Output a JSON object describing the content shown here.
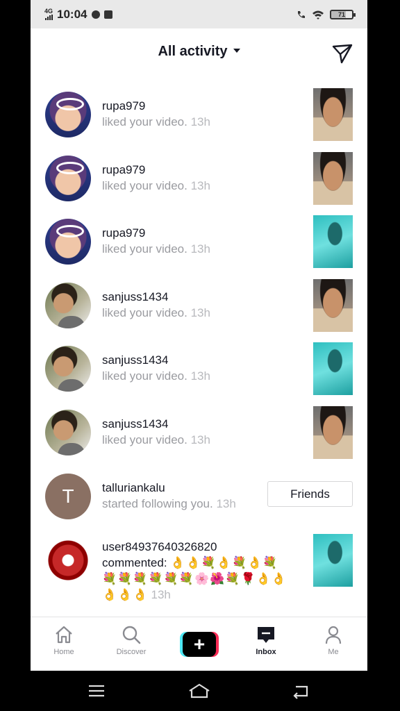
{
  "status_bar": {
    "network": "4G",
    "time": "10:04",
    "battery": "71"
  },
  "header": {
    "title": "All activity",
    "send_icon": "paper-plane-icon"
  },
  "notifications": [
    {
      "username": "rupa979",
      "action": "liked your video.",
      "time": "13h",
      "avatar": "girl",
      "thumb": "face"
    },
    {
      "username": "rupa979",
      "action": "liked your video.",
      "time": "13h",
      "avatar": "girl",
      "thumb": "face"
    },
    {
      "username": "rupa979",
      "action": "liked your video.",
      "time": "13h",
      "avatar": "girl",
      "thumb": "teal"
    },
    {
      "username": "sanjuss1434",
      "action": "liked your video.",
      "time": "13h",
      "avatar": "man",
      "thumb": "face"
    },
    {
      "username": "sanjuss1434",
      "action": "liked your video.",
      "time": "13h",
      "avatar": "man",
      "thumb": "teal"
    },
    {
      "username": "sanjuss1434",
      "action": "liked your video.",
      "time": "13h",
      "avatar": "man",
      "thumb": "face"
    }
  ],
  "follow": {
    "username": "talluriankalu",
    "avatar_letter": "T",
    "action": "started following you.",
    "time": "13h",
    "button_label": "Friends"
  },
  "comment": {
    "username": "user84937640326820",
    "action": "commented:",
    "emojis_line1": "👌👌💐👌💐👌💐",
    "emojis_line2": "💐💐💐💐💐💐🌸🌺💐🌹👌👌",
    "emojis_line3": "👌👌👌",
    "time": "13h"
  },
  "bottom_nav": {
    "home": "Home",
    "discover": "Discover",
    "create": "+",
    "inbox": "Inbox",
    "me": "Me",
    "active": "Inbox"
  },
  "colors": {
    "text_primary": "#161823",
    "text_secondary": "#9a9ba0",
    "create_cyan": "#4de8f4",
    "create_red": "#fa2c56"
  }
}
